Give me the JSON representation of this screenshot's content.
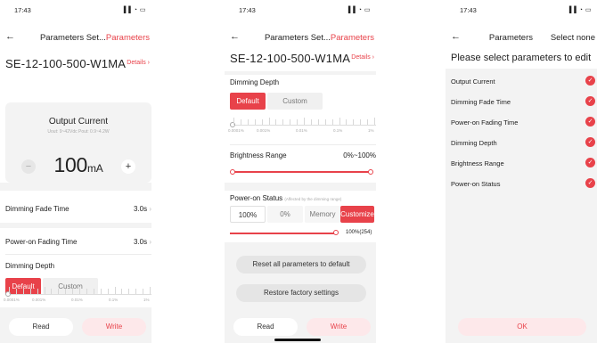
{
  "status": {
    "time": "17:43",
    "icons": "▐▐ ◔ ▭"
  },
  "icons": {
    "back": "back-arrow-icon",
    "chevron": "chevron-right-icon",
    "check": "check-icon",
    "signal": "signal-wifi-battery-icon"
  },
  "colors": {
    "accent": "#e8424a",
    "panel": "#f3f3f3"
  },
  "screen1": {
    "nav_title_black": "Parameters Set...",
    "nav_title_red": "Parameters",
    "device_name": "SE-12-100-500-W1MA",
    "details": "Details",
    "output_current": {
      "title": "Output Current",
      "subtitle": "Uout: 9~42Vdc  Pout: 0.9~4.2W",
      "value": "100",
      "unit": "mA",
      "minus": "−",
      "plus": "+"
    },
    "rows": [
      {
        "label": "Dimming Fade Time",
        "value": "3.0s"
      },
      {
        "label": "Power-on Fading Time",
        "value": "3.0s"
      }
    ],
    "dimming_depth": {
      "label": "Dimming Depth",
      "default": "Default",
      "custom": "Custom",
      "ticks": [
        "0.0001%",
        "0.001%",
        "0.01%",
        "0.1%",
        "1%"
      ]
    },
    "read": "Read",
    "write": "Write"
  },
  "screen2": {
    "nav_title_black": "Parameters Set...",
    "nav_title_red": "Parameters",
    "device_name": "SE-12-100-500-W1MA",
    "details": "Details",
    "dimming_depth": {
      "label": "Dimming Depth",
      "default": "Default",
      "custom": "Custom",
      "ticks": [
        "0.0001%",
        "0.001%",
        "0.01%",
        "0.1%",
        "1%"
      ]
    },
    "brightness": {
      "label": "Brightness Range",
      "value": "0%~100%"
    },
    "power_on": {
      "label": "Power-on Status",
      "note": "(Affected by the dimming range)",
      "options": [
        "100%",
        "0%",
        "Memory",
        "Customize"
      ],
      "value": "100%(254)"
    },
    "reset": "Reset all parameters to default",
    "restore": "Restore factory settings",
    "read": "Read",
    "write": "Write"
  },
  "screen3": {
    "nav_title": "Parameters",
    "select_none": "Select none",
    "heading": "Please select parameters to edit",
    "items": [
      "Output Current",
      "Dimming Fade Time",
      "Power-on Fading Time",
      "Dimming Depth",
      "Brightness Range",
      "Power-on Status"
    ],
    "check": "✓",
    "ok": "OK"
  }
}
